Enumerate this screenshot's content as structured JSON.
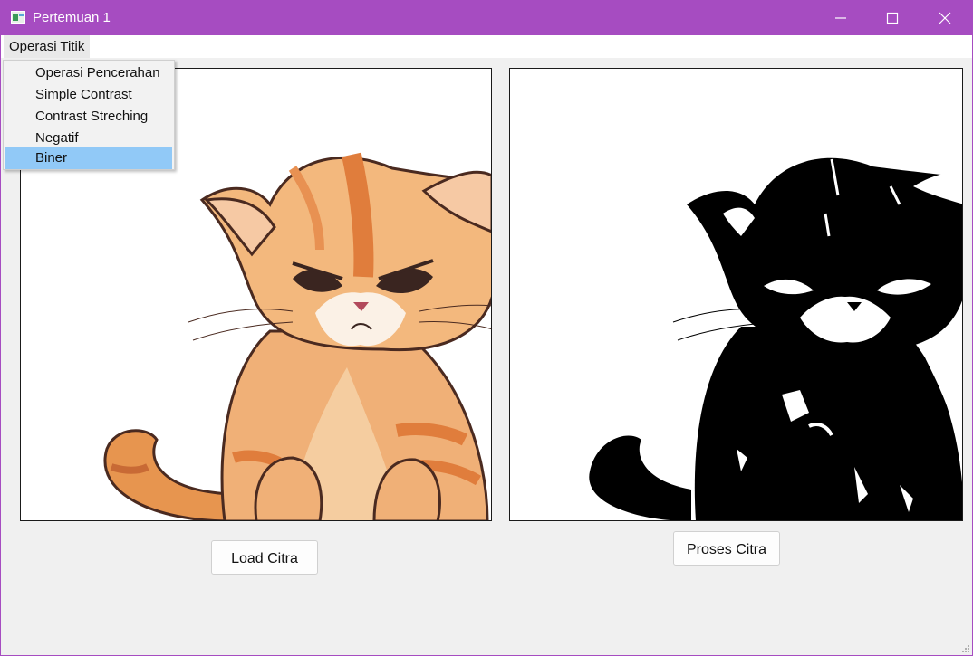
{
  "window": {
    "title": "Pertemuan 1"
  },
  "menubar": {
    "menu_title": "Operasi Titik"
  },
  "dropdown": {
    "items": [
      {
        "label": "Operasi Pencerahan",
        "selected": false
      },
      {
        "label": "Simple Contrast",
        "selected": false
      },
      {
        "label": "Contrast Streching",
        "selected": false
      },
      {
        "label": "Negatif",
        "selected": false
      },
      {
        "label": "Biner",
        "selected": true
      }
    ]
  },
  "buttons": {
    "load_label": "Load Citra",
    "proses_label": "Proses Citra"
  },
  "icons": {
    "app": "window-app-icon",
    "minimize": "minimize-icon",
    "maximize": "maximize-icon",
    "close": "close-icon"
  },
  "colors": {
    "titlebar": "#a64cc1",
    "selection": "#91c9f7",
    "background": "#f0f0f0"
  }
}
